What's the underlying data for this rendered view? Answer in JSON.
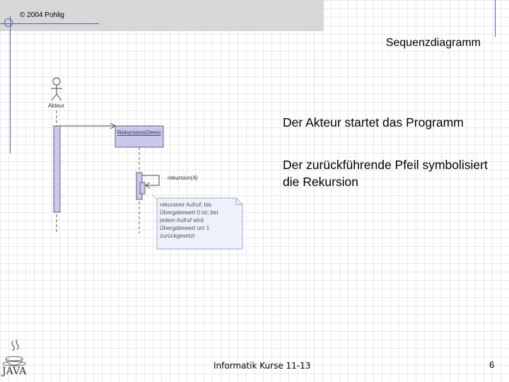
{
  "header": {
    "copyright": "© 2004 Pohlig"
  },
  "title": "Sequenzdiagramm",
  "bullets": [
    "Der Akteur startet das Programm",
    "Der zurückführende Pfeil symbolisiert die Rekursion"
  ],
  "diagram": {
    "actor_label": "Akteur",
    "object_label": "RekursionsDemo",
    "message_label": "rekursion(4)",
    "note_lines": [
      "rekursiver Aufruf; bis",
      "Übergabewert 0 ist; bei",
      "jedem Aufruf wird",
      "Übergabewert um 1",
      "zurückgesetzt"
    ]
  },
  "footer": {
    "course": "Informatik Kurse 11-13",
    "page_number": "6",
    "logo_text": "JAVA"
  },
  "colors": {
    "frame": "#4a64b0",
    "activation": "#c8c8f0",
    "note_fill": "#eef0fa",
    "note_border": "#a0a8d8"
  }
}
